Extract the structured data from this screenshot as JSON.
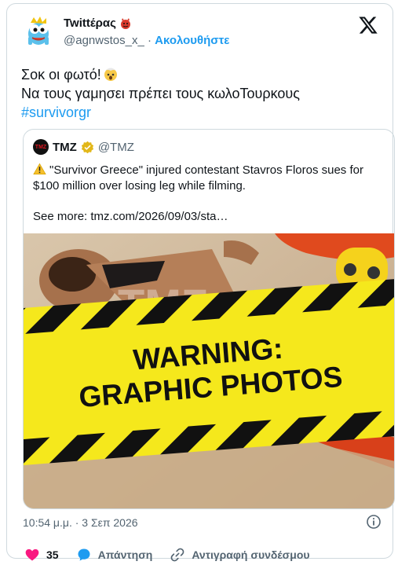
{
  "author": {
    "display_name": "Twittέρας",
    "handle": "@agnwstos_x_",
    "separator": "·",
    "follow_label": "Ακολουθήστε"
  },
  "tweet": {
    "line1": "Σοκ οι φωτό!",
    "line2": "Να τους γαμησει πρέπει τους κωλοΤουρκους",
    "hashtag": "#survivorgr"
  },
  "quoted": {
    "name": "TMZ",
    "handle": "@TMZ",
    "logo_text": "TMZ",
    "body": "\"Survivor Greece\" injured contestant Stavros Floros sues for $100 million over losing leg while filming.",
    "see_more": "See more: tmz.com/2026/09/03/sta…",
    "image": {
      "warning_line1": "WARNING:",
      "warning_line2": "GRAPHIC PHOTOS",
      "watermark": "TMZ"
    }
  },
  "meta": {
    "timestamp": "10:54 μ.μ. · 3 Σεπ 2026"
  },
  "actions": {
    "like_count": "35",
    "reply_label": "Απάντηση",
    "copy_link_label": "Αντιγραφή συνδέσμου"
  },
  "colors": {
    "accent": "#1d9bf0",
    "like": "#f91880",
    "warning_yellow": "#f5e81c",
    "verified_gold": "#e2b719"
  }
}
